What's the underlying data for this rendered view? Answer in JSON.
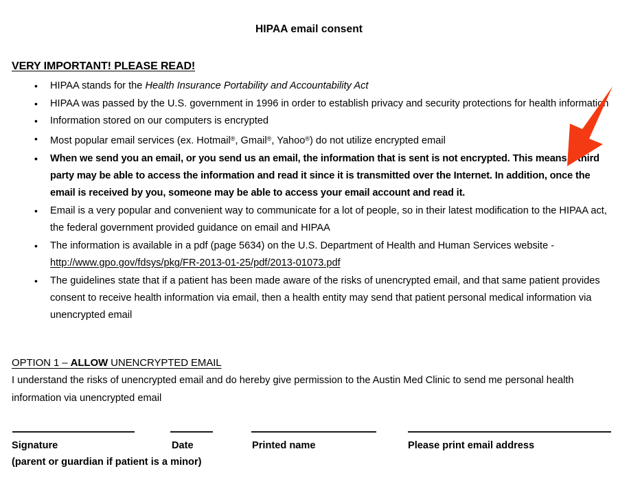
{
  "document": {
    "title": "HIPAA email consent",
    "section_heading": "VERY IMPORTANT! PLEASE READ!"
  },
  "bullets": {
    "item1_prefix": "HIPAA stands for the ",
    "item1_italic": "Health Insurance Portability and Accountability Act",
    "item2": "HIPAA was passed by the U.S. government in 1996 in order to establish privacy and security protections for health information",
    "item3": "Information stored on our computers is encrypted",
    "item4_a": "Most popular email services (ex. Hotmail",
    "item4_b": ", Gmail",
    "item4_c": ", Yahoo",
    "item4_d": ") do not utilize encrypted email",
    "reg_mark": "®",
    "item5_bold": "When we send you an email, or you send us an email, the information that is sent is not encrypted. This means a third party may be able to access the information and read it since it is transmitted over the Internet. In addition, once the email is received by you, someone may be able to access your email account and read it.",
    "item6": "Email is a very popular and convenient way to communicate for a lot of people, so in their latest modification to the HIPAA act, the federal government provided guidance on email and HIPAA",
    "item7_text": "The information is available in a pdf (page 5634) on the U.S. Department of Health and Human Services website - ",
    "item7_url": "http://www.gpo.gov/fdsys/pkg/FR-2013-01-25/pdf/2013-01073.pdf",
    "item8": "The guidelines state that if a patient has been made aware of the risks of unencrypted email, and that same patient provides consent to receive health information via email, then a health entity may send that patient personal medical information via unencrypted email"
  },
  "option": {
    "heading_prefix": "OPTION 1 – ",
    "heading_bold": "ALLOW",
    "heading_suffix": " UNENCRYPTED EMAIL",
    "body": "I understand the risks of unencrypted email and do hereby give permission to the Austin Med Clinic to send me personal health information via unencrypted email"
  },
  "signature": {
    "label_signature": "Signature",
    "sublabel_signature": "(parent or guardian if patient is a minor)",
    "label_date": "Date",
    "label_printed_name": "Printed name",
    "label_email": "Please print email address"
  },
  "annotation": {
    "arrow_icon": "red-down-left-arrow",
    "arrow_color": "#F43A12"
  }
}
